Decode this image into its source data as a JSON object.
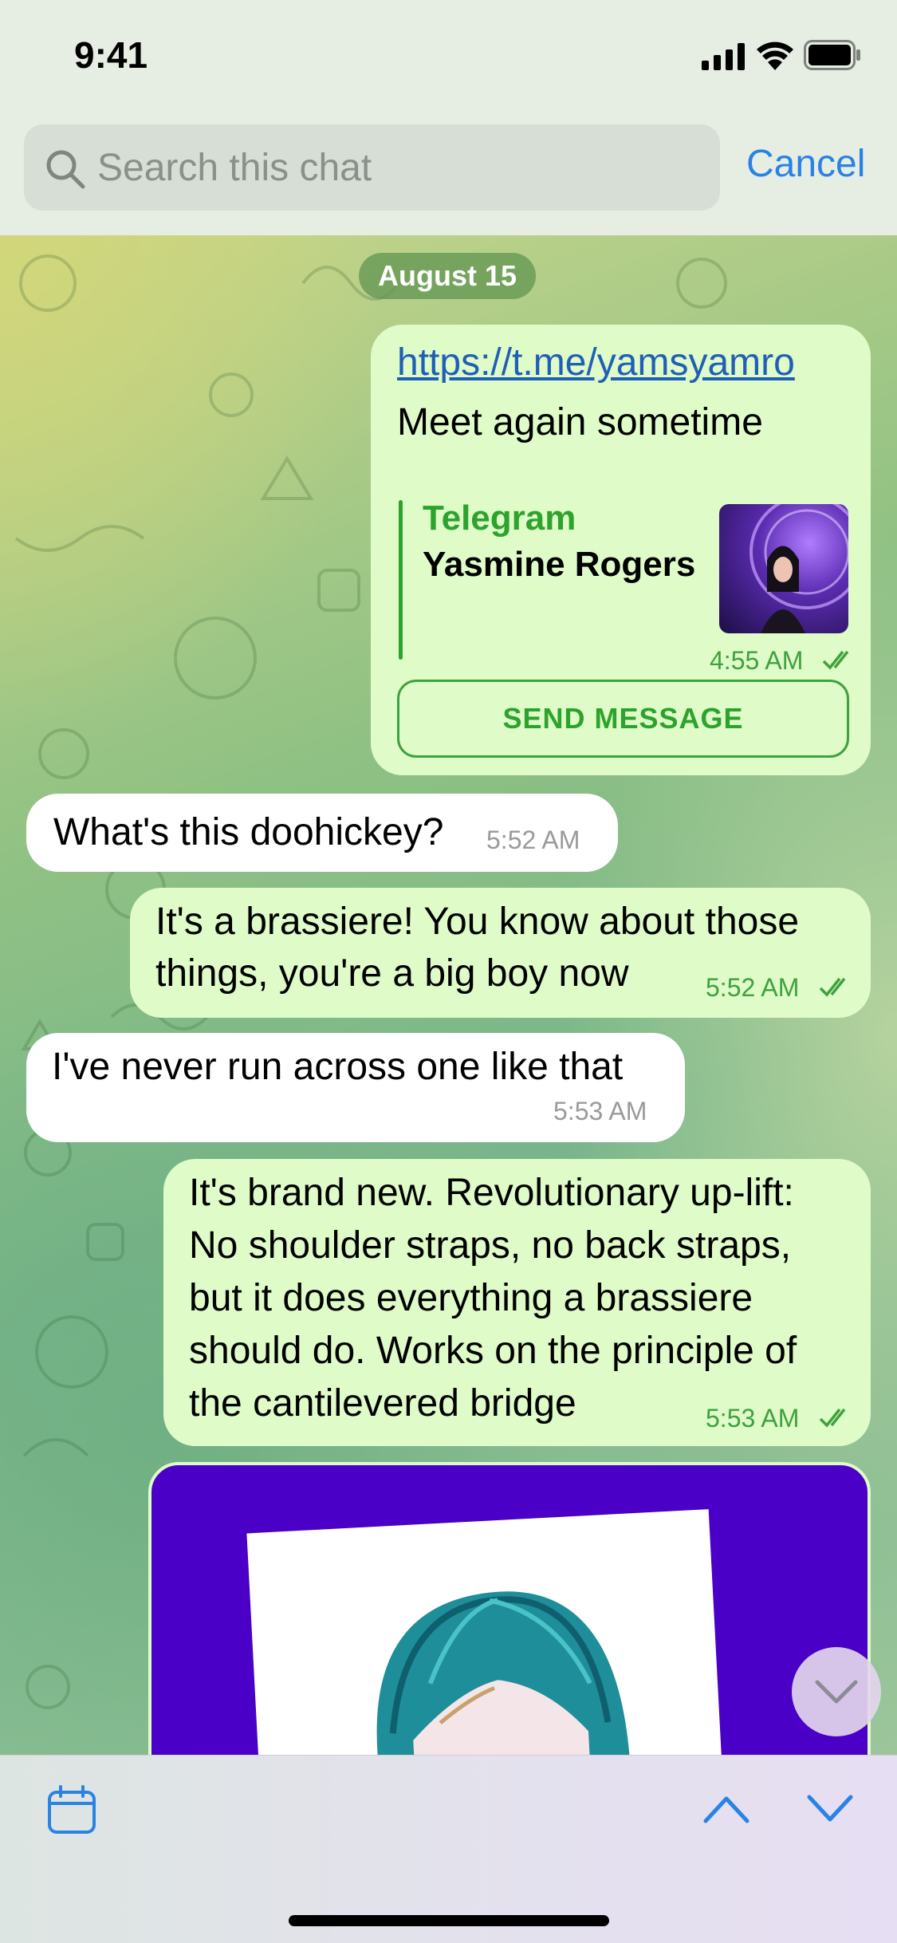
{
  "status_bar": {
    "time": "9:41"
  },
  "search": {
    "placeholder": "Search this chat",
    "value": "",
    "cancel_label": "Cancel"
  },
  "chat": {
    "date_label": "August 15",
    "link_message": {
      "url": "https://t.me/yamsyamro",
      "text": "Meet again sometime",
      "preview_site": "Telegram",
      "preview_title": "Yasmine Rogers",
      "time": "4:55 AM",
      "button_label": "SEND MESSAGE"
    },
    "messages": [
      {
        "direction": "incoming",
        "text": "What's this doohickey?",
        "time": "5:52 AM"
      },
      {
        "direction": "outgoing",
        "lines": [
          "It's a brassiere! You know about those",
          "things, you're a big boy now"
        ],
        "time": "5:52 AM"
      },
      {
        "direction": "incoming",
        "text": "I've never run across one like that",
        "time": "5:53 AM"
      },
      {
        "direction": "outgoing",
        "lines": [
          "It's brand new. Revolutionary up-lift:",
          "No shoulder straps, no back straps,",
          "but it does everything a brassiere",
          "should do. Works on the principle of",
          "the cantilevered bridge"
        ],
        "time": "5:53 AM"
      }
    ]
  },
  "colors": {
    "outgoing_bubble": "#dffbc8",
    "incoming_bubble": "#ffffff",
    "accent_green": "#2da32d",
    "link_blue": "#1f5fb6",
    "ios_blue": "#2a82e4",
    "photo_background": "#4a00c6"
  },
  "icons": {
    "status": [
      "signal-icon",
      "wifi-icon",
      "battery-icon"
    ],
    "search": "search-icon",
    "read_receipt": "double-check-icon",
    "scroll": "chevron-down-icon",
    "bottom_bar": [
      "calendar-icon",
      "chevron-up-icon",
      "chevron-down-icon"
    ]
  }
}
